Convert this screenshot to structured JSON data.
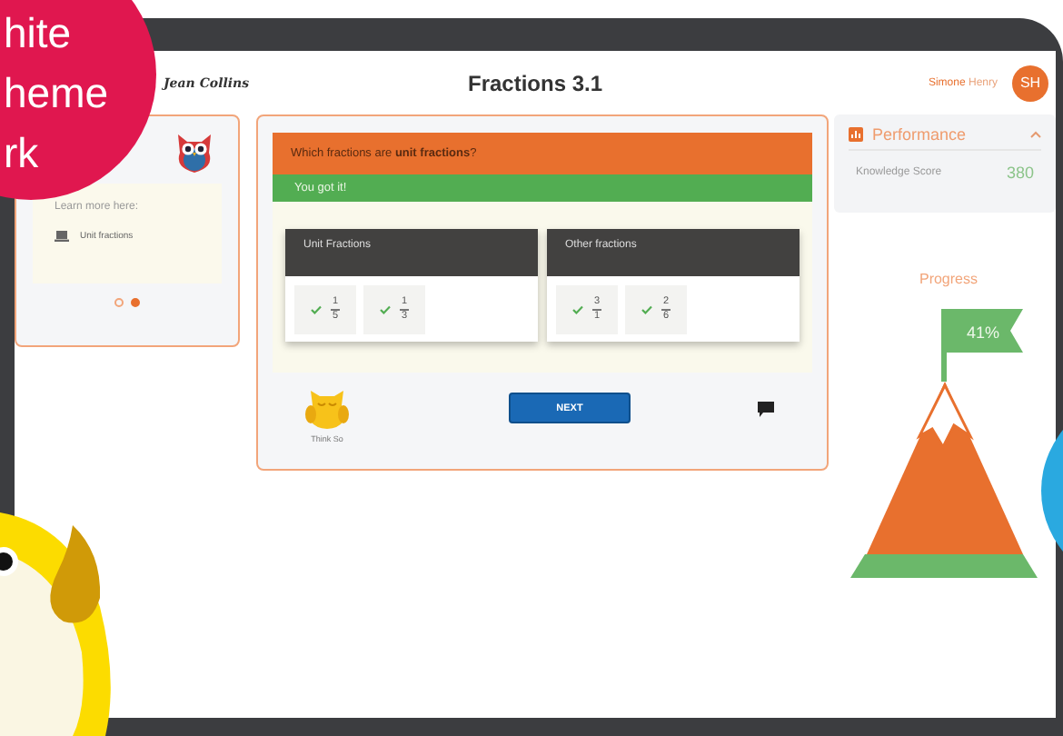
{
  "badge": {
    "lines": [
      "hite",
      "heme",
      "rk"
    ]
  },
  "header": {
    "logo": "Jean Collins",
    "title": "Fractions 3.1",
    "user": {
      "first": "Simone",
      "last": "Henry",
      "initials": "SH"
    }
  },
  "help_card": {
    "heading": "Learn more here:",
    "links": [
      {
        "label": "Unit fractions"
      }
    ],
    "dots": [
      {
        "selected": false
      },
      {
        "selected": true
      }
    ]
  },
  "question": {
    "prompt": "Which fractions are **unit fractions**?",
    "feedback": "You got it!",
    "groups": [
      {
        "title": "Unit Fractions",
        "tiles": [
          {
            "numerator": "1",
            "denominator": "5",
            "correct": true
          },
          {
            "numerator": "1",
            "denominator": "3",
            "correct": true
          }
        ]
      },
      {
        "title": "Other fractions",
        "tiles": [
          {
            "numerator": "3",
            "denominator": "1",
            "correct": true
          },
          {
            "numerator": "2",
            "denominator": "6",
            "correct": true
          }
        ]
      }
    ],
    "mascot_label": "Think So",
    "next_button": "NEXT"
  },
  "performance": {
    "title": "Performance",
    "expanded": true,
    "metrics": [
      {
        "label": "Knowledge Score",
        "value": "380"
      }
    ]
  },
  "progress": {
    "title": "Progress",
    "reading": "41%"
  }
}
